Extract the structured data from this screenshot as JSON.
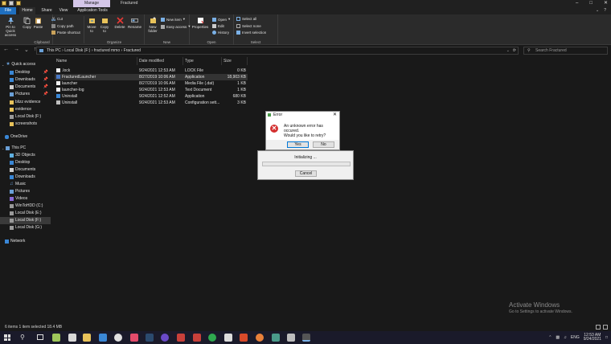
{
  "titlebar": {
    "manage_tab": "Manage",
    "title": "Fractured",
    "minimize": "–",
    "maximize": "□",
    "close": "✕"
  },
  "ribbon_tabs": {
    "file": "File",
    "home": "Home",
    "share": "Share",
    "view": "View",
    "application_tools": "Application Tools"
  },
  "ribbon": {
    "clipboard": {
      "pin_label": "Pin to Quick access",
      "copy_label": "Copy",
      "paste_label": "Paste",
      "cut_label": "Cut",
      "copy_path_label": "Copy path",
      "paste_shortcut_label": "Paste shortcut",
      "group_label": "Clipboard"
    },
    "organize": {
      "move_to_label": "Move to",
      "copy_to_label": "Copy to",
      "delete_label": "Delete",
      "rename_label": "Rename",
      "group_label": "Organize"
    },
    "new": {
      "new_folder_label": "New folder",
      "new_item_label": "New item",
      "easy_access_label": "Easy access",
      "group_label": "New"
    },
    "open": {
      "properties_label": "Properties",
      "open_label": "Open",
      "edit_label": "Edit",
      "history_label": "History",
      "group_label": "Open"
    },
    "select": {
      "select_all_label": "Select all",
      "select_none_label": "Select none",
      "invert_selection_label": "Invert selection",
      "group_label": "Select"
    }
  },
  "address": {
    "back": "←",
    "forward": "→",
    "recent": "⌄",
    "up": "↑",
    "path": "This PC  ›  Local Disk (F:)  ›  fractured mmo  ›  Fractured",
    "refresh": "⟳",
    "search_placeholder": "Search Fractured"
  },
  "nav": {
    "items": [
      {
        "label": "Quick access"
      },
      {
        "label": "Desktop"
      },
      {
        "label": "Downloads"
      },
      {
        "label": "Documents"
      },
      {
        "label": "Pictures"
      },
      {
        "label": "blizz evidence"
      },
      {
        "label": "evidence"
      },
      {
        "label": "Local Disk (F:)"
      },
      {
        "label": "screenshots"
      },
      {
        "label": "OneDrive"
      },
      {
        "label": "This PC"
      },
      {
        "label": "3D Objects"
      },
      {
        "label": "Desktop"
      },
      {
        "label": "Documents"
      },
      {
        "label": "Downloads"
      },
      {
        "label": "Music"
      },
      {
        "label": "Pictures"
      },
      {
        "label": "Videos"
      },
      {
        "label": "WinToHDD (C:)"
      },
      {
        "label": "Local Disk (E:)"
      },
      {
        "label": "Local Disk (F:)"
      },
      {
        "label": "Local Disk (G:)"
      },
      {
        "label": "Network"
      }
    ]
  },
  "files": {
    "headers": {
      "name": "Name",
      "date": "Date modified",
      "type": "Type",
      "size": "Size"
    },
    "rows": [
      {
        "name": ".lock",
        "date": "9/24/2021 12:53 AM",
        "type": "LOCK File",
        "size": "0 KB"
      },
      {
        "name": "FracturedLauncher",
        "date": "8/27/2019 10:06 AM",
        "type": "Application",
        "size": "18,903 KB"
      },
      {
        "name": "launcher",
        "date": "8/27/2019 10:06 AM",
        "type": "Media File (.dat)",
        "size": "1 KB"
      },
      {
        "name": "launcher-log",
        "date": "9/24/2021 12:53 AM",
        "type": "Text Document",
        "size": "1 KB"
      },
      {
        "name": "Uninstall",
        "date": "9/24/2021 12:52 AM",
        "type": "Application",
        "size": "680 KB"
      },
      {
        "name": "Uninstall",
        "date": "9/24/2021 12:53 AM",
        "type": "Configuration sett...",
        "size": "3 KB"
      }
    ]
  },
  "error_dialog": {
    "title": "Error",
    "close": "✕",
    "icon": "✕",
    "line1": "An unknown error has occured.",
    "line2": "Would you like to retry?",
    "yes_label": "Yes",
    "no_label": "No"
  },
  "progress_dialog": {
    "title": "Initializing ...",
    "progress": 0.0,
    "cancel_label": "Cancel"
  },
  "status": {
    "text": "6 items    1 item selected  18.4 MB"
  },
  "watermark": {
    "line1": "Activate Windows",
    "line2": "Go to Settings to activate Windows."
  },
  "taskbar": {
    "language": "ENG",
    "time": "12:53 AM",
    "date": "9/24/2021"
  },
  "colors": {
    "accent": "#1f6fbf",
    "error_red": "#d32f2f",
    "folder_yellow": "#e8c25a"
  }
}
